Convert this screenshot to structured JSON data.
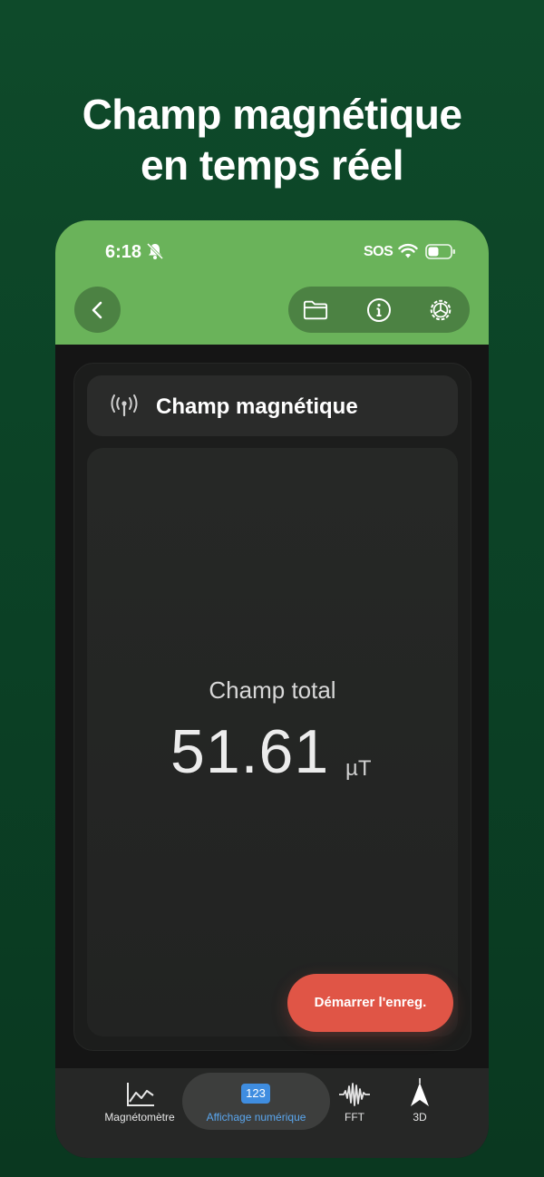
{
  "headline": {
    "line1": "Champ magnétique",
    "line2": "en temps réel"
  },
  "status_bar": {
    "time": "6:18",
    "carrier": "SOS"
  },
  "toolbar": {
    "back_icon": "chevron-left-icon",
    "folder_icon": "folder-icon",
    "info_icon": "info-icon",
    "settings_icon": "settings-icon"
  },
  "card": {
    "title": "Champ magnétique",
    "icon": "antenna-icon"
  },
  "reading": {
    "label": "Champ total",
    "value": "51.61",
    "unit": "µT"
  },
  "record_button": {
    "label": "Démarrer l'enreg."
  },
  "tabs": [
    {
      "label": "Magnétomètre",
      "icon": "line-chart-icon",
      "active": false
    },
    {
      "label": "Affichage numérique",
      "icon": "numeric-123-icon",
      "icon_text": "123",
      "active": true
    },
    {
      "label": "FFT",
      "icon": "waveform-icon",
      "active": false
    },
    {
      "label": "3D",
      "icon": "arrow-3d-icon",
      "active": false
    }
  ],
  "colors": {
    "background": "#0e4a2a",
    "topbar": "#6ab35a",
    "record": "#e05546",
    "active_tab_label": "#5aa6ee",
    "numeric_icon_bg": "#3f8de0"
  }
}
